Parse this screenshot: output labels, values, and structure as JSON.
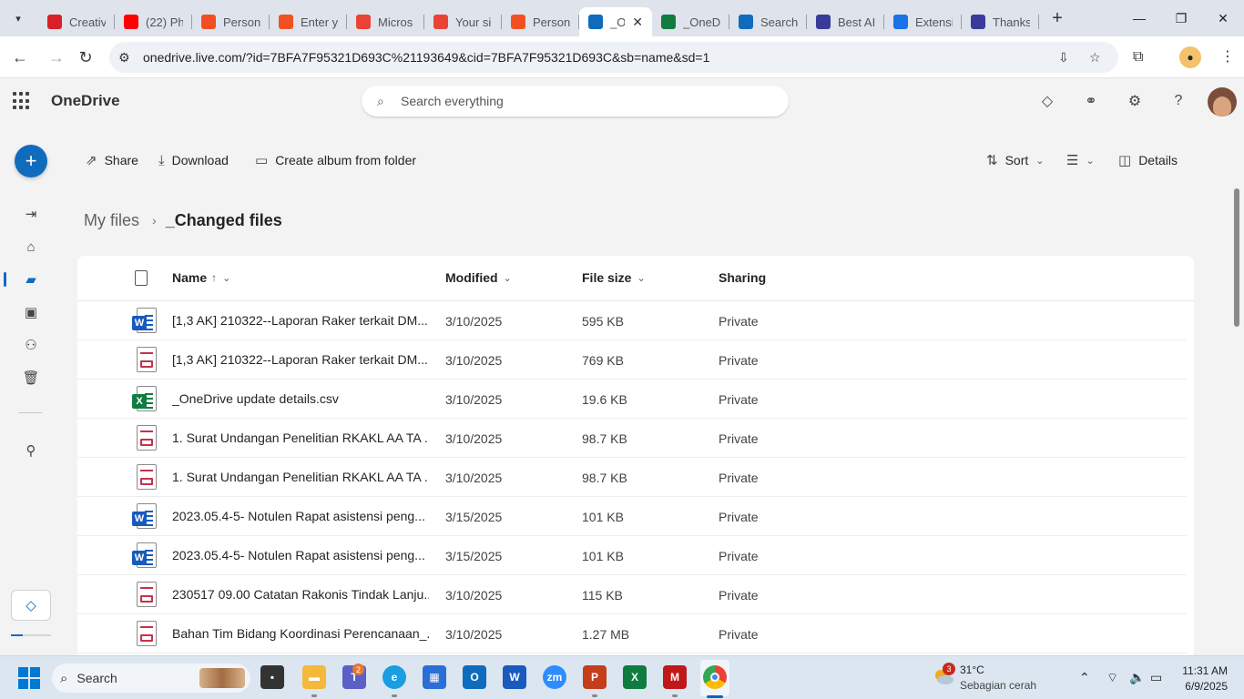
{
  "browser": {
    "tabs": [
      {
        "title": "Creativ",
        "icon": "adobe-icon",
        "color": "#da1f26",
        "active": false
      },
      {
        "title": "(22) Ph",
        "icon": "youtube-icon",
        "color": "#ff0000",
        "active": false
      },
      {
        "title": "Person",
        "icon": "microsoft-icon",
        "color": "#f25022",
        "active": false
      },
      {
        "title": "Enter y",
        "icon": "microsoft-icon",
        "color": "#f25022",
        "active": false
      },
      {
        "title": "Micros",
        "icon": "gmail-icon",
        "color": "#ea4335",
        "active": false
      },
      {
        "title": "Your si",
        "icon": "gmail-icon",
        "color": "#ea4335",
        "active": false
      },
      {
        "title": "Person",
        "icon": "microsoft-icon",
        "color": "#f25022",
        "active": false
      },
      {
        "title": "_O",
        "icon": "onedrive-icon",
        "color": "#0f6cbd",
        "active": true
      },
      {
        "title": "_OneD",
        "icon": "excel-icon",
        "color": "#107c41",
        "active": false
      },
      {
        "title": "Search",
        "icon": "onedrive-icon",
        "color": "#0f6cbd",
        "active": false
      },
      {
        "title": "Best AI",
        "icon": "ai-icon",
        "color": "#3a3a9a",
        "active": false
      },
      {
        "title": "Extensi",
        "icon": "puzzle-icon",
        "color": "#1a73e8",
        "active": false
      },
      {
        "title": "Thanks",
        "icon": "ai-icon",
        "color": "#3a3a9a",
        "active": false
      }
    ],
    "url": "onedrive.live.com/?id=7BFA7F95321D693C%21193649&cid=7BFA7F95321D693C&sb=name&sd=1"
  },
  "app": {
    "title": "OneDrive",
    "search_placeholder": "Search everything"
  },
  "commands": {
    "share": "Share",
    "download": "Download",
    "create_album": "Create album from folder",
    "sort": "Sort",
    "details": "Details"
  },
  "breadcrumb": {
    "root": "My files",
    "current": "_Changed files"
  },
  "columns": {
    "name": "Name",
    "modified": "Modified",
    "size": "File size",
    "sharing": "Sharing"
  },
  "files": [
    {
      "name": "[1,3 AK] 210322--Laporan Raker terkait DM...",
      "type": "word",
      "modified": "3/10/2025",
      "size": "595 KB",
      "sharing": "Private"
    },
    {
      "name": "[1,3 AK] 210322--Laporan Raker terkait DM...",
      "type": "pdf",
      "modified": "3/10/2025",
      "size": "769 KB",
      "sharing": "Private"
    },
    {
      "name": "_OneDrive update details.csv",
      "type": "excel",
      "modified": "3/10/2025",
      "size": "19.6 KB",
      "sharing": "Private"
    },
    {
      "name": "1. Surat Undangan Penelitian RKAKL AA TA ...",
      "type": "pdf",
      "modified": "3/10/2025",
      "size": "98.7 KB",
      "sharing": "Private"
    },
    {
      "name": "1. Surat Undangan Penelitian RKAKL AA TA ...",
      "type": "pdf",
      "modified": "3/10/2025",
      "size": "98.7 KB",
      "sharing": "Private"
    },
    {
      "name": "2023.05.4-5-  Notulen Rapat asistensi peng...",
      "type": "word",
      "modified": "3/15/2025",
      "size": "101 KB",
      "sharing": "Private"
    },
    {
      "name": "2023.05.4-5-  Notulen Rapat asistensi peng...",
      "type": "word",
      "modified": "3/15/2025",
      "size": "101 KB",
      "sharing": "Private"
    },
    {
      "name": "230517 09.00 Catatan Rakonis Tindak Lanju...",
      "type": "pdf",
      "modified": "3/10/2025",
      "size": "115 KB",
      "sharing": "Private"
    },
    {
      "name": "Bahan Tim Bidang Koordinasi Perencanaan_...",
      "type": "pdf",
      "modified": "3/10/2025",
      "size": "1.27 MB",
      "sharing": "Private"
    }
  ],
  "taskbar": {
    "search_label": "Search",
    "teams_badge": "2",
    "weather_badge": "3",
    "weather_temp": "31°C",
    "weather_desc": "Sebagian cerah",
    "time": "11:31 AM",
    "date": "6/9/2025"
  },
  "colors": {
    "accent": "#0f6cbd",
    "word": "#185abd",
    "excel": "#107c41",
    "pdf": "#c4314b"
  }
}
